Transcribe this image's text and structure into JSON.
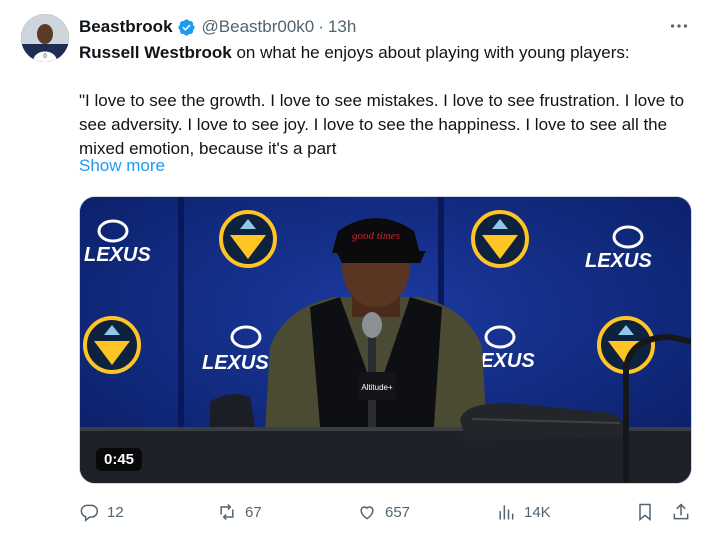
{
  "tweet": {
    "author_name": "Beastbrook",
    "handle": "@Beastbr00k0",
    "separator": "·",
    "time": "13h",
    "subject": "Russell Westbrook",
    "intro": " on what he enjoys about playing with young players:",
    "quote": "\"I love to see the growth. I love to see mistakes. I love to see frustration. I love to see adversity. I love to see joy. I love to see the happiness. I love to see all the mixed emotion, because it's a part",
    "show_more": "Show more"
  },
  "media": {
    "duration": "0:45",
    "sign_text": "LEXUS",
    "cap_text": "good times",
    "mic_text": "Altitude+"
  },
  "actions": {
    "replies": "12",
    "reposts": "67",
    "likes": "657",
    "views": "14K"
  },
  "icons": {
    "more": "more-icon",
    "verified": "verified-badge-icon",
    "reply": "reply-icon",
    "repost": "repost-icon",
    "like": "like-icon",
    "views": "views-icon",
    "bookmark": "bookmark-icon",
    "share": "share-icon"
  },
  "colors": {
    "link": "#1d9bf0",
    "verified": "#1d9bf0",
    "muted": "#536471"
  }
}
